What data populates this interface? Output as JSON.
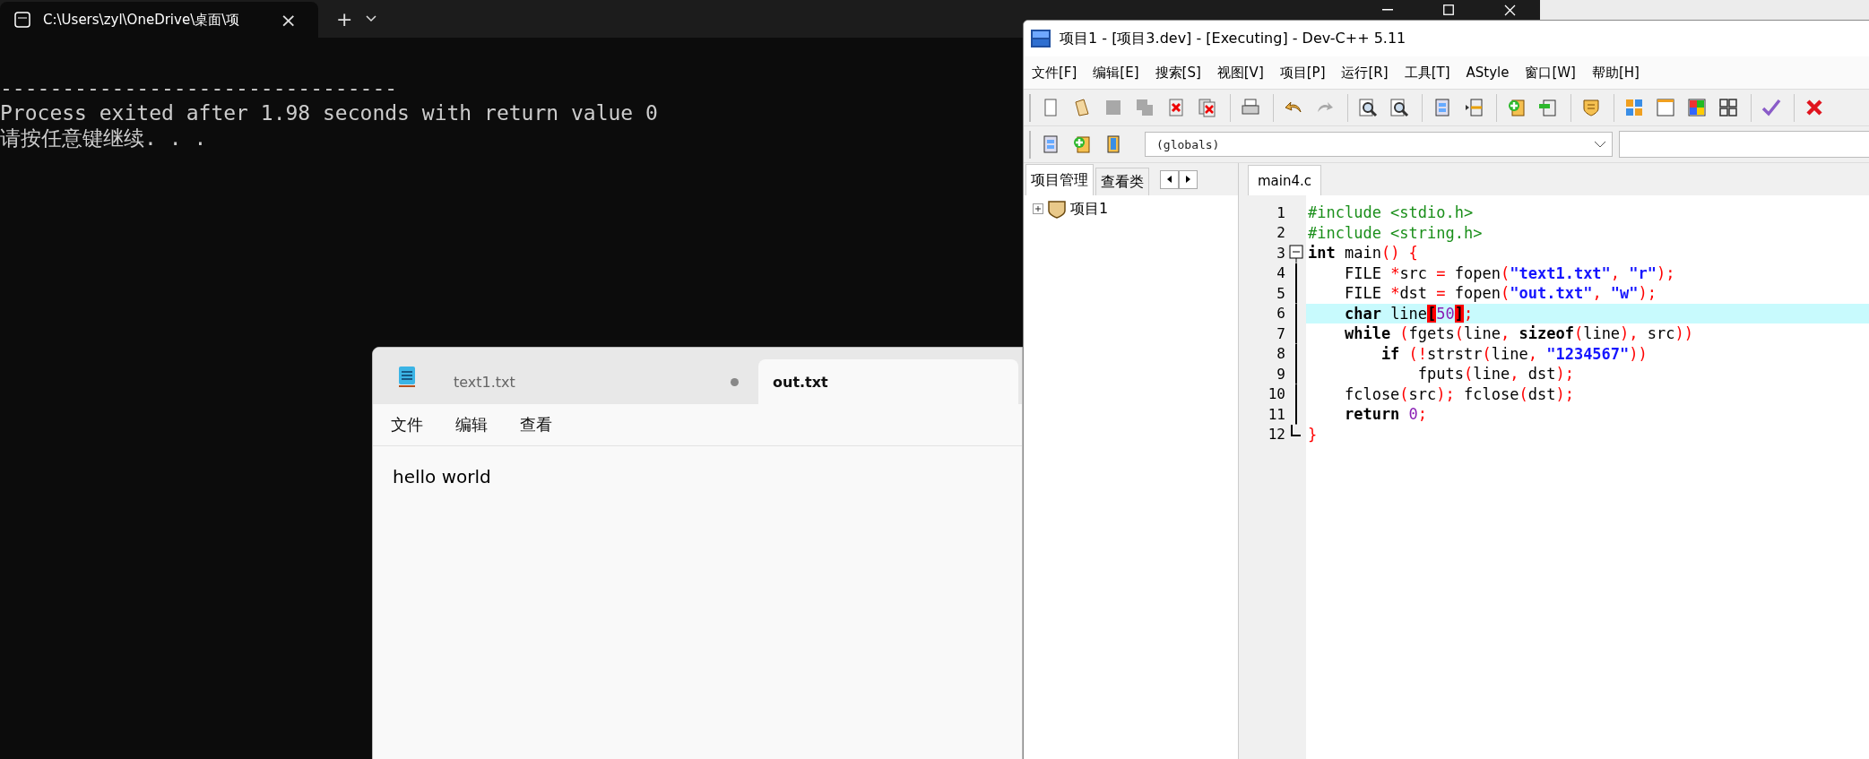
{
  "terminal": {
    "tab_title": "C:\\Users\\zyl\\OneDrive\\桌面\\项",
    "close": "×",
    "new_tab": "+",
    "output": [
      {
        "text": "--------------------------------"
      },
      {
        "text": "Process exited after 1.98 seconds with return value 0"
      },
      {
        "text": "请按任意键继续. . ."
      }
    ]
  },
  "notepad": {
    "tabs": [
      {
        "label": "text1.txt",
        "selected": false,
        "modified": true
      },
      {
        "label": "out.txt",
        "selected": true,
        "modified": false
      }
    ],
    "menu": [
      "文件",
      "编辑",
      "查看"
    ],
    "content": "hello world"
  },
  "devcpp": {
    "title": "项目1 - [项目3.dev] - [Executing] - Dev-C++ 5.11",
    "menu": [
      "文件[F]",
      "编辑[E]",
      "搜索[S]",
      "视图[V]",
      "项目[P]",
      "运行[R]",
      "工具[T]",
      "AStyle",
      "窗口[W]",
      "帮助[H]"
    ],
    "toolbar": [
      [
        {
          "kind": "new",
          "disabled": false
        },
        {
          "kind": "open",
          "disabled": false
        },
        {
          "kind": "save",
          "disabled": true
        },
        {
          "kind": "save-all",
          "disabled": true
        },
        {
          "kind": "close",
          "disabled": false
        },
        {
          "kind": "close-all",
          "disabled": false
        }
      ],
      [
        {
          "kind": "print",
          "disabled": false
        }
      ],
      [
        {
          "kind": "undo",
          "disabled": false
        },
        {
          "kind": "redo",
          "disabled": true
        }
      ],
      [
        {
          "kind": "find",
          "disabled": false
        },
        {
          "kind": "find",
          "disabled": false
        }
      ],
      [
        {
          "kind": "panel",
          "disabled": false
        },
        {
          "kind": "split",
          "disabled": false
        }
      ],
      [
        {
          "kind": "add",
          "disabled": false
        },
        {
          "kind": "remove",
          "disabled": false
        }
      ],
      [
        {
          "kind": "shield",
          "disabled": false
        }
      ],
      [
        {
          "kind": "colors",
          "disabled": false
        },
        {
          "kind": "window",
          "disabled": false
        },
        {
          "kind": "tiles",
          "disabled": false
        },
        {
          "kind": "grid",
          "disabled": false
        }
      ],
      [
        {
          "kind": "check",
          "disabled": false
        }
      ],
      [
        {
          "kind": "cross",
          "disabled": false
        }
      ]
    ],
    "toolbar2": [
      {
        "kind": "panel",
        "disabled": false
      },
      {
        "kind": "add",
        "disabled": false
      },
      {
        "kind": "book",
        "disabled": false
      }
    ],
    "scope_combo": "(globals)",
    "panel_tabs": [
      {
        "label": "项目管理",
        "selected": true
      },
      {
        "label": "查看类",
        "selected": false
      }
    ],
    "tree": [
      {
        "label": "项目1",
        "expanded": false
      }
    ],
    "editor_tab": "main4.c",
    "lines": [
      {
        "number": "1",
        "highlighted": false,
        "kind": "plain",
        "tokens": [
          {
            "kind": "preproc",
            "text": "#include <stdio.h>"
          }
        ]
      },
      {
        "number": "2",
        "highlighted": false,
        "kind": "plain",
        "tokens": [
          {
            "kind": "preproc",
            "text": "#include <string.h>"
          }
        ]
      },
      {
        "number": "3",
        "highlighted": false,
        "kind": "fold-start",
        "tokens": [
          {
            "kind": "keyword",
            "text": "int"
          },
          {
            "kind": "plain",
            "text": " main"
          },
          {
            "kind": "symbol",
            "text": "() {"
          }
        ]
      },
      {
        "number": "4",
        "highlighted": false,
        "kind": "fold-body",
        "tokens": [
          {
            "kind": "plain",
            "text": "    FILE "
          },
          {
            "kind": "symbol",
            "text": "*"
          },
          {
            "kind": "plain",
            "text": "src "
          },
          {
            "kind": "symbol",
            "text": "="
          },
          {
            "kind": "plain",
            "text": " fopen"
          },
          {
            "kind": "symbol",
            "text": "("
          },
          {
            "kind": "string",
            "text": "\"text1.txt\""
          },
          {
            "kind": "symbol",
            "text": ", "
          },
          {
            "kind": "string",
            "text": "\"r\""
          },
          {
            "kind": "symbol",
            "text": ");"
          }
        ]
      },
      {
        "number": "5",
        "highlighted": false,
        "kind": "fold-body",
        "tokens": [
          {
            "kind": "plain",
            "text": "    FILE "
          },
          {
            "kind": "symbol",
            "text": "*"
          },
          {
            "kind": "plain",
            "text": "dst "
          },
          {
            "kind": "symbol",
            "text": "="
          },
          {
            "kind": "plain",
            "text": " fopen"
          },
          {
            "kind": "symbol",
            "text": "("
          },
          {
            "kind": "string",
            "text": "\"out.txt\""
          },
          {
            "kind": "symbol",
            "text": ", "
          },
          {
            "kind": "string",
            "text": "\"w\""
          },
          {
            "kind": "symbol",
            "text": ");"
          }
        ]
      },
      {
        "number": "6",
        "highlighted": true,
        "kind": "fold-body",
        "tokens": [
          {
            "kind": "keyword",
            "text": "    char"
          },
          {
            "kind": "plain",
            "text": " line"
          },
          {
            "kind": "brace",
            "text": "["
          },
          {
            "kind": "number",
            "text": "50"
          },
          {
            "kind": "brace",
            "text": "]"
          },
          {
            "kind": "symbol",
            "text": ";"
          }
        ]
      },
      {
        "number": "7",
        "highlighted": false,
        "kind": "fold-body",
        "tokens": [
          {
            "kind": "keyword",
            "text": "    while"
          },
          {
            "kind": "symbol",
            "text": " ("
          },
          {
            "kind": "plain",
            "text": "fgets"
          },
          {
            "kind": "symbol",
            "text": "("
          },
          {
            "kind": "plain",
            "text": "line"
          },
          {
            "kind": "symbol",
            "text": ", "
          },
          {
            "kind": "keyword",
            "text": "sizeof"
          },
          {
            "kind": "symbol",
            "text": "("
          },
          {
            "kind": "plain",
            "text": "line"
          },
          {
            "kind": "symbol",
            "text": "), "
          },
          {
            "kind": "plain",
            "text": "src"
          },
          {
            "kind": "symbol",
            "text": "))"
          }
        ]
      },
      {
        "number": "8",
        "highlighted": false,
        "kind": "fold-body",
        "tokens": [
          {
            "kind": "keyword",
            "text": "        if"
          },
          {
            "kind": "symbol",
            "text": " (!"
          },
          {
            "kind": "plain",
            "text": "strstr"
          },
          {
            "kind": "symbol",
            "text": "("
          },
          {
            "kind": "plain",
            "text": "line"
          },
          {
            "kind": "symbol",
            "text": ", "
          },
          {
            "kind": "string",
            "text": "\"1234567\""
          },
          {
            "kind": "symbol",
            "text": "))"
          }
        ]
      },
      {
        "number": "9",
        "highlighted": false,
        "kind": "fold-body",
        "tokens": [
          {
            "kind": "plain",
            "text": "            fputs"
          },
          {
            "kind": "symbol",
            "text": "("
          },
          {
            "kind": "plain",
            "text": "line"
          },
          {
            "kind": "symbol",
            "text": ", "
          },
          {
            "kind": "plain",
            "text": "dst"
          },
          {
            "kind": "symbol",
            "text": ");"
          }
        ]
      },
      {
        "number": "10",
        "highlighted": false,
        "kind": "fold-body",
        "tokens": [
          {
            "kind": "plain",
            "text": "    fclose"
          },
          {
            "kind": "symbol",
            "text": "("
          },
          {
            "kind": "plain",
            "text": "src"
          },
          {
            "kind": "symbol",
            "text": "); "
          },
          {
            "kind": "plain",
            "text": "fclose"
          },
          {
            "kind": "symbol",
            "text": "("
          },
          {
            "kind": "plain",
            "text": "dst"
          },
          {
            "kind": "symbol",
            "text": ");"
          }
        ]
      },
      {
        "number": "11",
        "highlighted": false,
        "kind": "fold-body",
        "tokens": [
          {
            "kind": "keyword",
            "text": "    return"
          },
          {
            "kind": "number",
            "text": " 0"
          },
          {
            "kind": "symbol",
            "text": ";"
          }
        ]
      },
      {
        "number": "12",
        "highlighted": false,
        "kind": "fold-end",
        "tokens": [
          {
            "kind": "symbol",
            "text": "}"
          }
        ]
      }
    ]
  }
}
